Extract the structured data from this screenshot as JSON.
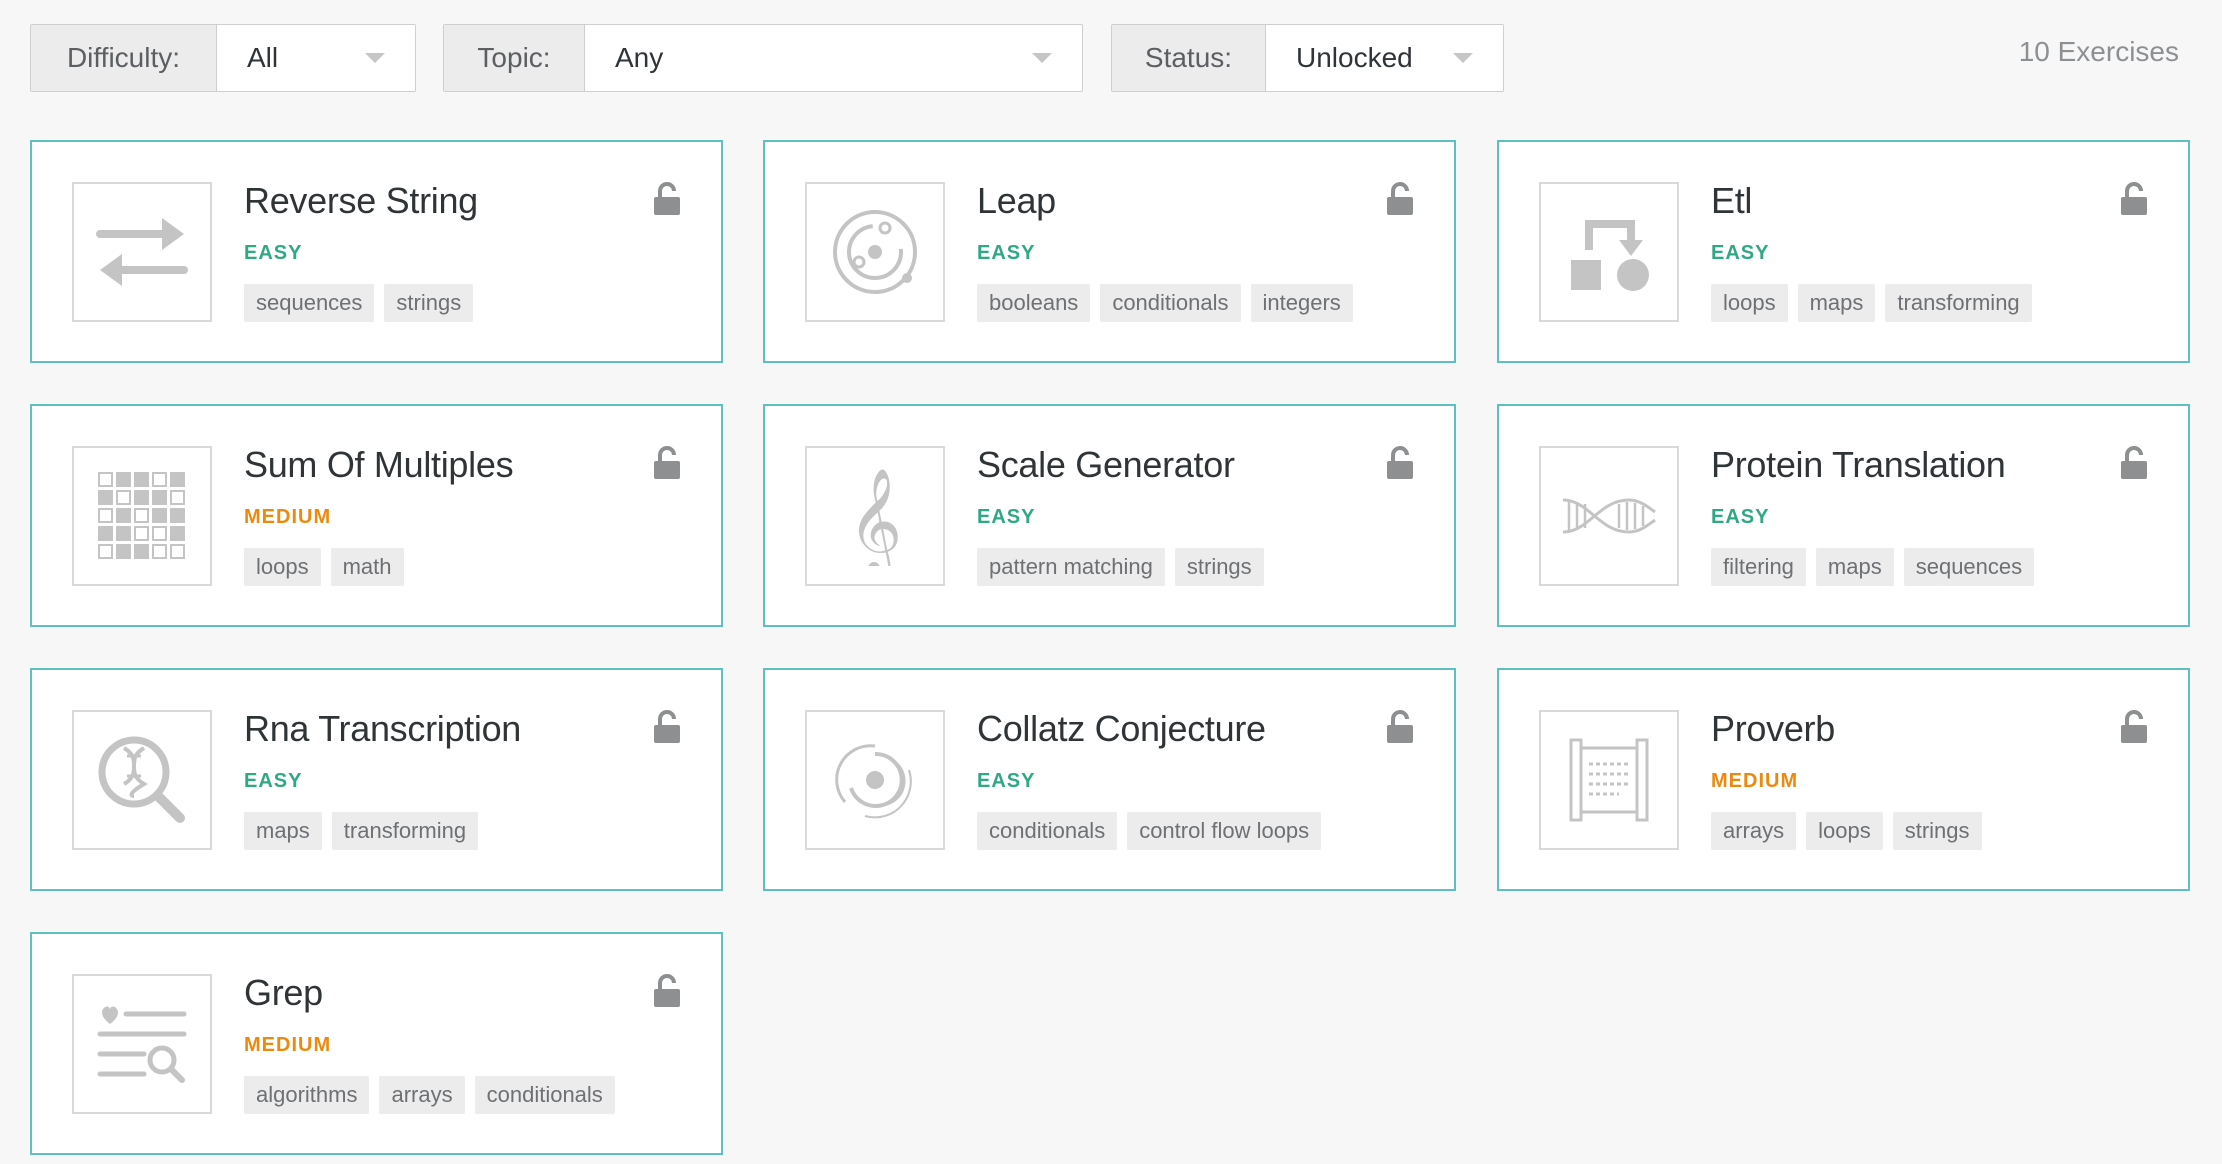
{
  "filters": {
    "difficulty": {
      "label": "Difficulty:",
      "value": "All"
    },
    "topic": {
      "label": "Topic:",
      "value": "Any"
    },
    "status": {
      "label": "Status:",
      "value": "Unlocked"
    }
  },
  "exercise_count": "10 Exercises",
  "colors": {
    "easy": "#2fa884",
    "medium": "#ec8a10",
    "card_border": "#5ec0c5"
  },
  "exercises": [
    {
      "title": "Reverse String",
      "difficulty": "EASY",
      "level": "easy",
      "icon": "reverse-arrows-icon",
      "status_icon": "unlocked-padlock-icon",
      "tags": [
        "sequences",
        "strings"
      ]
    },
    {
      "title": "Leap",
      "difficulty": "EASY",
      "level": "easy",
      "icon": "orbit-icon",
      "status_icon": "unlocked-padlock-icon",
      "tags": [
        "booleans",
        "conditionals",
        "integers"
      ]
    },
    {
      "title": "Etl",
      "difficulty": "EASY",
      "level": "easy",
      "icon": "transform-shapes-icon",
      "status_icon": "unlocked-padlock-icon",
      "tags": [
        "loops",
        "maps",
        "transforming"
      ]
    },
    {
      "title": "Sum Of Multiples",
      "difficulty": "MEDIUM",
      "level": "medium",
      "icon": "grid-icon",
      "status_icon": "unlocked-padlock-icon",
      "tags": [
        "loops",
        "math"
      ]
    },
    {
      "title": "Scale Generator",
      "difficulty": "EASY",
      "level": "easy",
      "icon": "treble-clef-icon",
      "status_icon": "unlocked-padlock-icon",
      "tags": [
        "pattern matching",
        "strings"
      ]
    },
    {
      "title": "Protein Translation",
      "difficulty": "EASY",
      "level": "easy",
      "icon": "dna-helix-icon",
      "status_icon": "unlocked-padlock-icon",
      "tags": [
        "filtering",
        "maps",
        "sequences"
      ]
    },
    {
      "title": "Rna Transcription",
      "difficulty": "EASY",
      "level": "easy",
      "icon": "dna-magnifier-icon",
      "status_icon": "unlocked-padlock-icon",
      "tags": [
        "maps",
        "transforming"
      ]
    },
    {
      "title": "Collatz Conjecture",
      "difficulty": "EASY",
      "level": "easy",
      "icon": "spiral-icon",
      "status_icon": "unlocked-padlock-icon",
      "tags": [
        "conditionals",
        "control flow loops"
      ]
    },
    {
      "title": "Proverb",
      "difficulty": "MEDIUM",
      "level": "medium",
      "icon": "scroll-icon",
      "status_icon": "unlocked-padlock-icon",
      "tags": [
        "arrays",
        "loops",
        "strings"
      ]
    },
    {
      "title": "Grep",
      "difficulty": "MEDIUM",
      "level": "medium",
      "icon": "search-list-icon",
      "status_icon": "unlocked-padlock-icon",
      "tags": [
        "algorithms",
        "arrays",
        "conditionals"
      ]
    }
  ]
}
